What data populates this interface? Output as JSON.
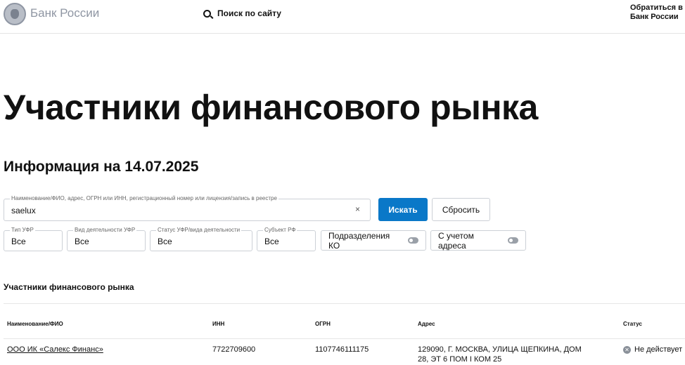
{
  "header": {
    "brand": "Банк России",
    "search": "Поиск по сайту",
    "contact": "Обратиться в Банк России"
  },
  "page": {
    "title": "Участники финансового рынка",
    "info": "Информация на 14.07.2025"
  },
  "search": {
    "label": "Наименование/ФИО, адрес, ОГРН или ИНН, регистрационный номер или лицензия/запись в реестре",
    "value": "saelux",
    "clear": "×",
    "submit": "Искать",
    "reset": "Сбросить"
  },
  "filters": [
    {
      "label": "Тип УФР",
      "value": "Все"
    },
    {
      "label": "Вид деятельности УФР",
      "value": "Все"
    },
    {
      "label": "Статус УФР/вида деятельности",
      "value": "Все"
    },
    {
      "label": "Субъект РФ",
      "value": "Все"
    }
  ],
  "toggles": [
    {
      "label": "Подразделения КО"
    },
    {
      "label": "С учетом адреса"
    }
  ],
  "table": {
    "title": "Участники финансового рынка",
    "headers": [
      "Наименование/ФИО",
      "ИНН",
      "ОГРН",
      "Адрес",
      "Статус"
    ],
    "rows": [
      {
        "name": "ООО ИК «Салекс Финанс»",
        "inn": "7722709600",
        "ogrn": "1107746111175",
        "address": "129090, Г. МОСКВА, УЛИЦА ЩЕПКИНА, ДОМ 28, ЭТ 6 ПОМ I КОМ 25",
        "status": "Не действует"
      }
    ]
  },
  "colors": {
    "accent": "#0a78c8"
  }
}
